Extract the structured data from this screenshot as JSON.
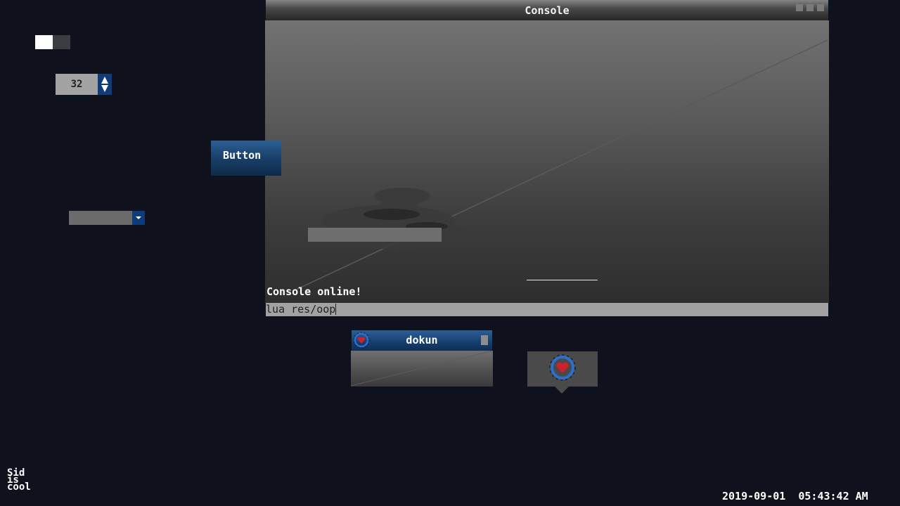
{
  "toggle": {
    "state": "on"
  },
  "spinbox": {
    "value": "32"
  },
  "button": {
    "label": "Button"
  },
  "dropdown": {
    "selected": ""
  },
  "console": {
    "title": "Console",
    "output_line": "Console online!",
    "input_value": "lua res/oop"
  },
  "dokun_window": {
    "title": "dokun"
  },
  "footer": {
    "sid_lines": [
      "Sid",
      "is",
      "cool"
    ],
    "date": "2019-09-01",
    "time": "05:43:42 AM"
  },
  "icons": {
    "spin_up": "triangle-up-icon",
    "spin_down": "triangle-down-icon",
    "dropdown_arrow": "chevron-down-icon",
    "logo": "heart-target-logo-icon"
  },
  "colors": {
    "background": "#0f121c",
    "accent_blue": "#0e3c78",
    "heart_red": "#d0202a",
    "ring_blue": "#2a6fd1"
  }
}
